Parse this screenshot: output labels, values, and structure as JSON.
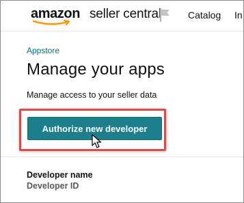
{
  "header": {
    "logo_amazon": "amazon",
    "logo_seller_central": "seller central",
    "flag_icon": "flag-icon",
    "nav_catalog": "Catalog",
    "nav_partial": "In"
  },
  "main": {
    "breadcrumb": "Appstore",
    "title": "Manage your apps",
    "subtitle": "Manage access to your seller data",
    "authorize_button": "Authorize new developer",
    "developer_name_label": "Developer name",
    "developer_id_label": "Developer ID"
  },
  "colors": {
    "button": "#1d7f8c",
    "highlight": "#e04848",
    "link": "#007185",
    "logo_smile": "#ff9900"
  },
  "icons": {
    "cursor": "pointer-cursor-icon"
  }
}
